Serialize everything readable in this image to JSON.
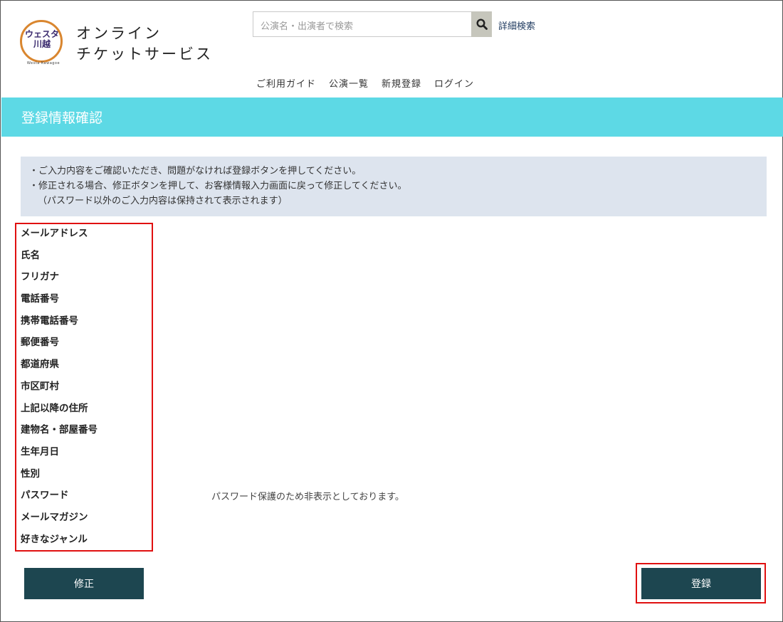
{
  "header": {
    "logo_text_line1": "ウェスタ",
    "logo_text_line2": "川越",
    "logo_subtext": "Westa Kawagoe",
    "site_title_line1": "オンライン",
    "site_title_line2": "チケットサービス",
    "search_placeholder": "公演名・出演者で検索",
    "detail_search_label": "詳細検索",
    "nav": [
      "ご利用ガイド",
      "公演一覧",
      "新規登録",
      "ログイン"
    ]
  },
  "page_title": "登録情報確認",
  "notice": {
    "line1": "・ご入力内容をご確認いただき、問題がなければ登録ボタンを押してください。",
    "line2": "・修正される場合、修正ボタンを押して、お客様情報入力画面に戻って修正してください。",
    "line3": "（パスワード以外のご入力内容は保持されて表示されます）"
  },
  "fields": [
    {
      "label": "メールアドレス",
      "value": ""
    },
    {
      "label": "氏名",
      "value": ""
    },
    {
      "label": "フリガナ",
      "value": ""
    },
    {
      "label": "電話番号",
      "value": ""
    },
    {
      "label": "携帯電話番号",
      "value": ""
    },
    {
      "label": "郵便番号",
      "value": ""
    },
    {
      "label": "都道府県",
      "value": ""
    },
    {
      "label": "市区町村",
      "value": ""
    },
    {
      "label": "上記以降の住所",
      "value": ""
    },
    {
      "label": "建物名・部屋番号",
      "value": ""
    },
    {
      "label": "生年月日",
      "value": ""
    },
    {
      "label": "性別",
      "value": ""
    },
    {
      "label": "パスワード",
      "value": "パスワード保護のため非表示としております。"
    },
    {
      "label": "メールマガジン",
      "value": ""
    },
    {
      "label": "好きなジャンル",
      "value": ""
    }
  ],
  "buttons": {
    "edit": "修正",
    "register": "登録"
  },
  "colors": {
    "banner": "#5dd9e5",
    "button": "#1d4650",
    "highlight": "#e01010",
    "notice_bg": "#dde4ee"
  }
}
